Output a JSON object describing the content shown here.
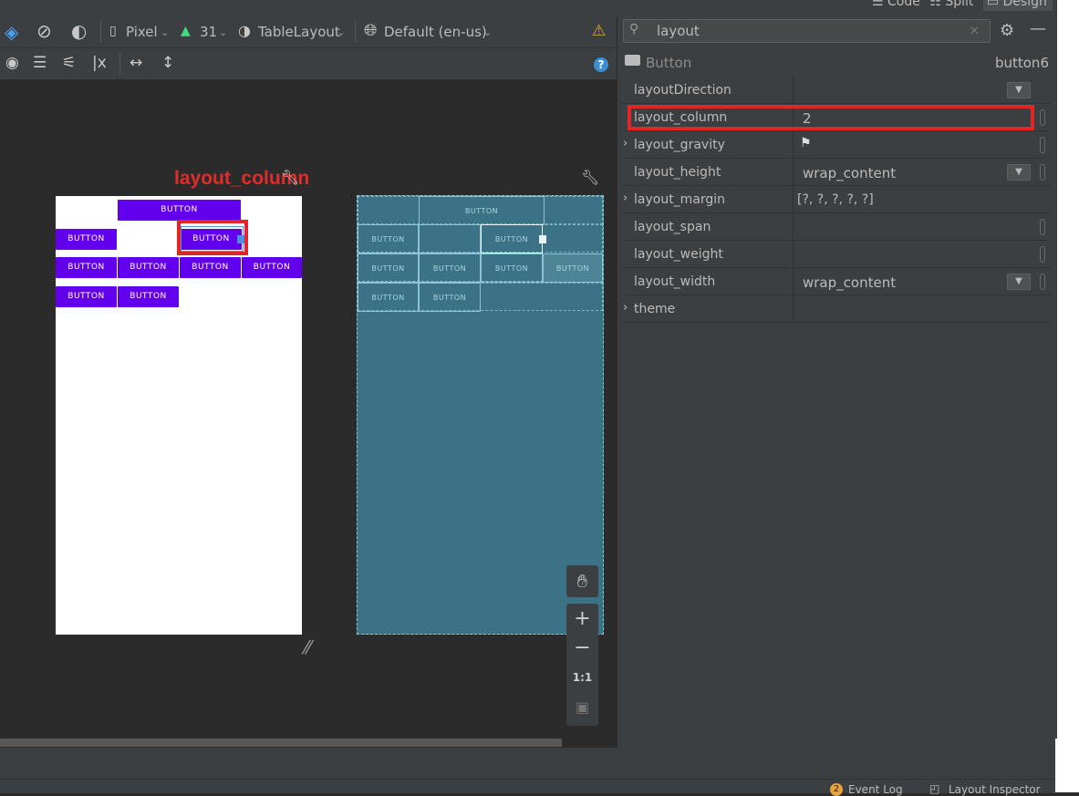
{
  "view_modes": {
    "code": "Code",
    "split": "Split",
    "design": "Design"
  },
  "toolbar": {
    "device": "Pixel",
    "api_level": "31",
    "layout_name": "TableLayout",
    "locale": "Default (en-us)"
  },
  "annotation": {
    "label": "layout_column"
  },
  "preview": {
    "button_text": "BUTTON",
    "blueprint_button_text": "BUTTON"
  },
  "zoom": {
    "actual_size_label": "1:1"
  },
  "attributes": {
    "search_value": "layout",
    "component_type": "Button",
    "component_id": "button6",
    "rows": [
      {
        "name": "layoutDirection",
        "value": ""
      },
      {
        "name": "layout_column",
        "value": "2"
      },
      {
        "name": "layout_gravity",
        "value": ""
      },
      {
        "name": "layout_height",
        "value": "wrap_content"
      },
      {
        "name": "layout_margin",
        "value": "[?, ?, ?, ?, ?]"
      },
      {
        "name": "layout_span",
        "value": ""
      },
      {
        "name": "layout_weight",
        "value": ""
      },
      {
        "name": "layout_width",
        "value": "wrap_content"
      },
      {
        "name": "theme",
        "value": ""
      }
    ]
  },
  "status_bar": {
    "event_log": "Event Log",
    "layout_inspector": "Layout Inspector"
  },
  "colors": {
    "accent_red": "#e0252b",
    "button_purple": "#6200ee",
    "blueprint": "#3b7285"
  }
}
